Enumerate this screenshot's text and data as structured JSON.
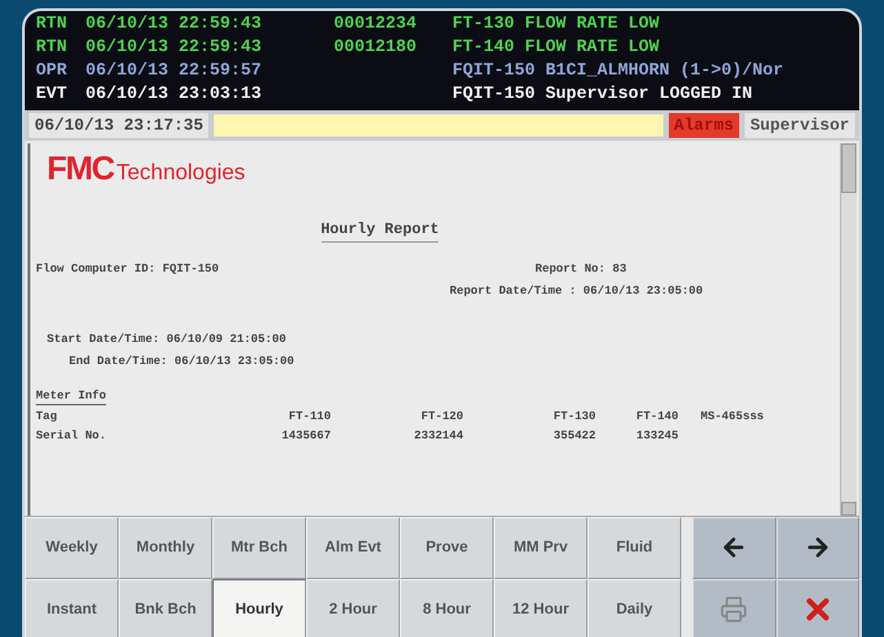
{
  "event_log": [
    {
      "kind": "rtn",
      "code": "RTN",
      "datetime": "06/10/13 22:59:43",
      "sequence": "00012234",
      "message": "FT-130 FLOW RATE LOW"
    },
    {
      "kind": "rtn",
      "code": "RTN",
      "datetime": "06/10/13 22:59:43",
      "sequence": "00012180",
      "message": "FT-140 FLOW RATE LOW"
    },
    {
      "kind": "opr",
      "code": "OPR",
      "datetime": "06/10/13 22:59:57",
      "message": "FQIT-150 B1CI_ALMHORN (1->0)/Nor"
    },
    {
      "kind": "evt",
      "code": "EVT",
      "datetime": "06/10/13 23:03:13",
      "message": "FQIT-150 Supervisor LOGGED IN"
    }
  ],
  "status_bar": {
    "clock": "06/10/13 23:17:35",
    "alarms": "Alarms",
    "user": "Supervisor"
  },
  "report": {
    "logo_mark": "FMC",
    "logo_text": "Technologies",
    "title": "Hourly Report",
    "flow_computer_id": "Flow Computer ID: FQIT-150",
    "report_no": "Report No: 83",
    "report_datetime": "Report Date/Time : 06/10/13 23:05:00",
    "start": "Start Date/Time: 06/10/09 21:05:00",
    "end": "End Date/Time: 06/10/13 23:05:00",
    "meter_info_heading": "Meter Info",
    "rows": [
      {
        "label": "Tag",
        "values": [
          "FT-110",
          "FT-120",
          "FT-130",
          "FT-140",
          "MS-465sss"
        ]
      },
      {
        "label": "Serial No.",
        "values": [
          "1435667",
          "2332144",
          "355422",
          "133245"
        ]
      }
    ]
  },
  "buttons": [
    [
      {
        "label": "Weekly",
        "selected": false
      },
      {
        "label": "Monthly",
        "selected": false
      },
      {
        "label": "Mtr Bch",
        "selected": false
      },
      {
        "label": "Alm Evt",
        "selected": false
      },
      {
        "label": "Prove",
        "selected": false
      },
      {
        "label": "MM Prv",
        "selected": false
      },
      {
        "label": "Fluid",
        "selected": false
      }
    ],
    [
      {
        "label": "Instant",
        "selected": false
      },
      {
        "label": "Bnk Bch",
        "selected": false
      },
      {
        "label": "Hourly",
        "selected": true
      },
      {
        "label": "2 Hour",
        "selected": false
      },
      {
        "label": "8 Hour",
        "selected": false
      },
      {
        "label": "12 Hour",
        "selected": false
      },
      {
        "label": "Daily",
        "selected": false
      }
    ]
  ],
  "tool_buttons": [
    [
      {
        "kind": "left"
      },
      {
        "kind": "right"
      }
    ],
    [
      {
        "kind": "print"
      },
      {
        "kind": "close"
      }
    ]
  ]
}
